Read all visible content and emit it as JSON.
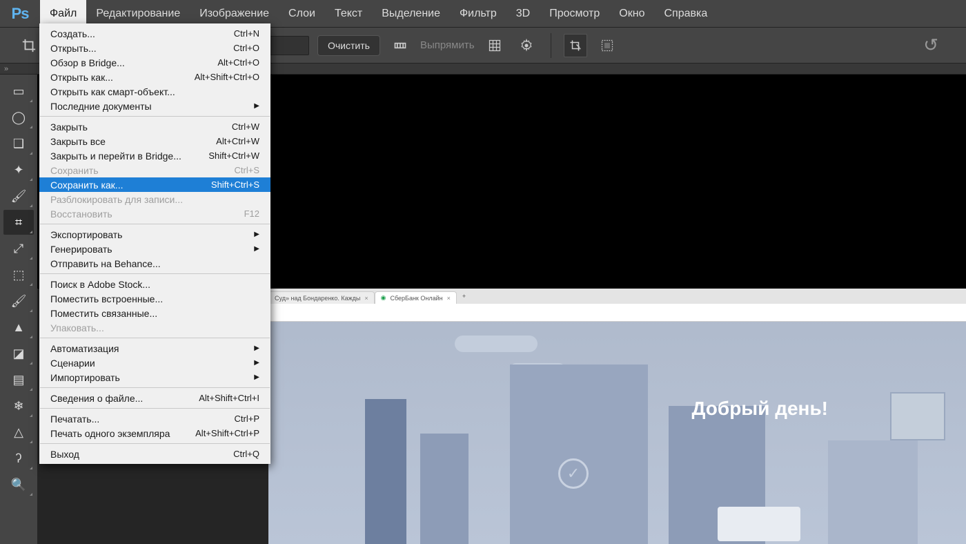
{
  "app": {
    "logo": "Ps"
  },
  "menu": [
    "Файл",
    "Редактирование",
    "Изображение",
    "Слои",
    "Текст",
    "Выделение",
    "Фильтр",
    "3D",
    "Просмотр",
    "Окно",
    "Справка"
  ],
  "menu_open_index": 0,
  "options": {
    "clear_btn": "Очистить",
    "straighten": "Выпрямить"
  },
  "handle": "»",
  "dropdown": [
    {
      "label": "Создать...",
      "shortcut": "Ctrl+N"
    },
    {
      "label": "Открыть...",
      "shortcut": "Ctrl+O"
    },
    {
      "label": "Обзор в Bridge...",
      "shortcut": "Alt+Ctrl+O"
    },
    {
      "label": "Открыть как...",
      "shortcut": "Alt+Shift+Ctrl+O"
    },
    {
      "label": "Открыть как смарт-объект..."
    },
    {
      "label": "Последние документы",
      "submenu": true
    },
    {
      "sep": true
    },
    {
      "label": "Закрыть",
      "shortcut": "Ctrl+W"
    },
    {
      "label": "Закрыть все",
      "shortcut": "Alt+Ctrl+W"
    },
    {
      "label": "Закрыть и перейти в Bridge...",
      "shortcut": "Shift+Ctrl+W"
    },
    {
      "label": "Сохранить",
      "shortcut": "Ctrl+S",
      "disabled": true
    },
    {
      "label": "Сохранить как...",
      "shortcut": "Shift+Ctrl+S",
      "highlight": true
    },
    {
      "label": "Разблокировать для записи...",
      "disabled": true
    },
    {
      "label": "Восстановить",
      "shortcut": "F12",
      "disabled": true
    },
    {
      "sep": true
    },
    {
      "label": "Экспортировать",
      "submenu": true
    },
    {
      "label": "Генерировать",
      "submenu": true
    },
    {
      "label": "Отправить на Behance..."
    },
    {
      "sep": true
    },
    {
      "label": "Поиск в Adobe Stock..."
    },
    {
      "label": "Поместить встроенные..."
    },
    {
      "label": "Поместить связанные..."
    },
    {
      "label": "Упаковать...",
      "disabled": true
    },
    {
      "sep": true
    },
    {
      "label": "Автоматизация",
      "submenu": true
    },
    {
      "label": "Сценарии",
      "submenu": true
    },
    {
      "label": "Импортировать",
      "submenu": true
    },
    {
      "sep": true
    },
    {
      "label": "Сведения о файле...",
      "shortcut": "Alt+Shift+Ctrl+I"
    },
    {
      "sep": true
    },
    {
      "label": "Печатать...",
      "shortcut": "Ctrl+P"
    },
    {
      "label": "Печать одного экземпляра",
      "shortcut": "Alt+Shift+Ctrl+P"
    },
    {
      "sep": true
    },
    {
      "label": "Выход",
      "shortcut": "Ctrl+Q"
    }
  ],
  "tools": [
    {
      "name": "marquee-rect",
      "glyph": "▭"
    },
    {
      "name": "marquee-ellipse",
      "glyph": "◯"
    },
    {
      "name": "lasso",
      "glyph": "❑"
    },
    {
      "name": "magic-wand",
      "glyph": "✦"
    },
    {
      "name": "brush-select",
      "glyph": "🖌"
    },
    {
      "name": "crop",
      "glyph": "⌗",
      "active": true
    },
    {
      "name": "slice",
      "glyph": "⤢"
    },
    {
      "name": "eyedropper",
      "glyph": "⬚"
    },
    {
      "name": "brush",
      "glyph": "🖌"
    },
    {
      "name": "clone",
      "glyph": "▲"
    },
    {
      "name": "eraser",
      "glyph": "◪"
    },
    {
      "name": "gradient",
      "glyph": "▤"
    },
    {
      "name": "blur",
      "glyph": "❄"
    },
    {
      "name": "pen",
      "glyph": "△"
    },
    {
      "name": "path",
      "glyph": "ʔ"
    },
    {
      "name": "zoom",
      "glyph": "🔍"
    }
  ],
  "canvas": {
    "greeting": "Добрый день!",
    "tab1": "Суд» над Бондаренко. Кажды",
    "tab2": "СберБанк Онлайн",
    "tab_close": "×",
    "tab_new": "+"
  }
}
